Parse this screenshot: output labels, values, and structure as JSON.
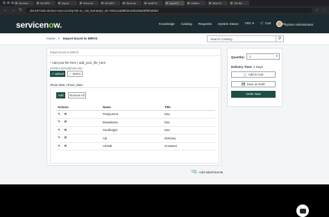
{
  "browser": {
    "tabs": [
      {
        "label": "Servicen",
        "active": false
      },
      {
        "label": "Set MRV",
        "active": false
      },
      {
        "label": "Import",
        "active": false
      },
      {
        "label": "Show da",
        "active": false
      },
      {
        "label": "Set MRV",
        "active": false
      },
      {
        "label": "Show da",
        "active": false
      },
      {
        "label": "readEXC",
        "active": false
      },
      {
        "label": "Import E",
        "active": true
      },
      {
        "label": "Untitled",
        "active": false
      },
      {
        "label": "Need Ex",
        "active": false
      },
      {
        "label": "The Blo",
        "active": false
      }
    ],
    "url": "dev197155.service-now.com/sp?id=sc_cat_item&sys_id=7e5cca4d6f02e10b106a09f6f4d3bd"
  },
  "header": {
    "logo_text_pre": "servicen",
    "logo_text_o": "o",
    "logo_text_post": "w.",
    "nav": [
      "Knowledge",
      "Catalog",
      "Requests",
      "System Status",
      "VRC ▾",
      "🛒 Cart",
      "Tours"
    ],
    "user_name": "System Administrator"
  },
  "breadcrumb": {
    "home": "Home",
    "separator": ">",
    "current": "Import Excel to MRVS"
  },
  "search": {
    "placeholder": "Search Catalog"
  },
  "form": {
    "title": "Import Excel to MRVS",
    "attachment_label": "Add your file here",
    "attachment_var": "add_your_file_here",
    "sheet_name": "Untitled spreadsheet.xlsx",
    "upload_label": "Upload",
    "select_label": "Select",
    "show_data_label": "Show data",
    "show_data_var": "show_data",
    "add_label": "Add",
    "remove_all_label": "Remove All",
    "columns": [
      "Actions",
      "Name",
      "Title"
    ],
    "rows": [
      {
        "name": "Pradyumna",
        "title": "Das"
      },
      {
        "name": "Biswaketan",
        "title": "Das"
      },
      {
        "name": "Soubhagini",
        "title": "Das"
      },
      {
        "name": "Ajit",
        "title": "Mohanty"
      },
      {
        "name": "Amitab",
        "title": "Goswami"
      }
    ],
    "add_attachments": "Add attachments"
  },
  "order": {
    "quantity_label": "Quantity:",
    "quantity_value": "1",
    "delivery_label": "Delivery Time:",
    "delivery_value": "2 Days",
    "add_to_cart": "Add to Cart",
    "save_as_draft": "Save as Draft",
    "order_now": "Order Now"
  },
  "colors": {
    "header_bg": "#1c2b2f",
    "logo_accent": "#8fd14f",
    "primary_button": "#1d4f47"
  }
}
